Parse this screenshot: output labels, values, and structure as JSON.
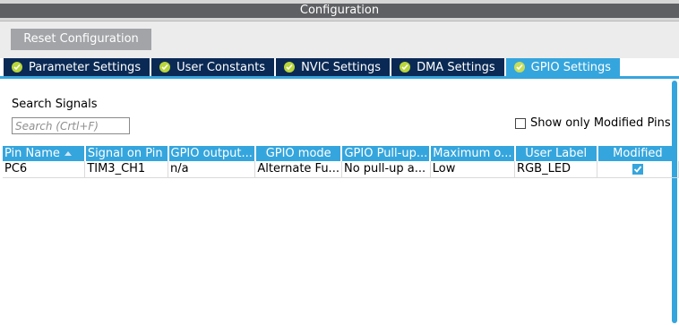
{
  "window": {
    "title": "Configuration"
  },
  "toolbar": {
    "reset_label": "Reset Configuration"
  },
  "tabs": [
    {
      "label": "Parameter Settings",
      "active": false
    },
    {
      "label": "User Constants",
      "active": false
    },
    {
      "label": "NVIC Settings",
      "active": false
    },
    {
      "label": "DMA Settings",
      "active": false
    },
    {
      "label": "GPIO Settings",
      "active": true
    }
  ],
  "search": {
    "label": "Search Signals",
    "placeholder": "Search (Crtl+F)",
    "value": ""
  },
  "filter": {
    "show_modified_label": "Show only Modified Pins",
    "checked": false
  },
  "table": {
    "columns": [
      "Pin Name",
      "Signal on Pin",
      "GPIO output...",
      "GPIO mode",
      "GPIO Pull-up...",
      "Maximum o...",
      "User Label",
      "Modified"
    ],
    "rows": [
      {
        "pin_name": "PC6",
        "signal": "TIM3_CH1",
        "gpio_output": "n/a",
        "gpio_mode": "Alternate Fu...",
        "pull": "No pull-up a...",
        "max_speed": "Low",
        "user_label": "RGB_LED",
        "modified": true
      }
    ]
  },
  "colors": {
    "accent": "#35a5dd",
    "tab_dark": "#0a2a55",
    "tab_check": "#b9d63a",
    "title_strip": "#5f6063",
    "button_gray": "#a2a4a7"
  }
}
